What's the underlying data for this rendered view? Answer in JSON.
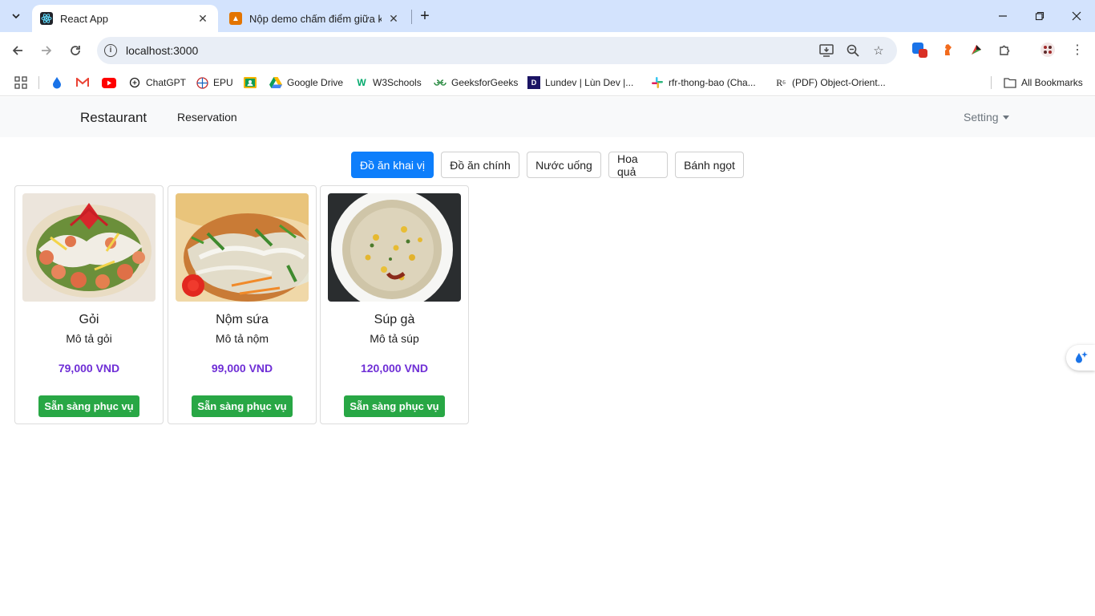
{
  "browser": {
    "tabs": [
      {
        "title": "React App",
        "active": true
      },
      {
        "title": "Nộp demo chấm điểm giữa kỳ",
        "active": false
      }
    ],
    "url": "localhost:3000",
    "bookmarks": [
      {
        "label": "ChatGPT"
      },
      {
        "label": "EPU"
      },
      {
        "label": "Google Drive"
      },
      {
        "label": "W3Schools"
      },
      {
        "label": "GeeksforGeeks"
      },
      {
        "label": "Lundev | Lùn Dev |..."
      },
      {
        "label": "rfr-thong-bao (Cha..."
      },
      {
        "label": "(PDF) Object-Orient..."
      }
    ],
    "all_bookmarks": "All Bookmarks",
    "extension_badge": "1"
  },
  "app": {
    "brand": "Restaurant",
    "nav_link": "Reservation",
    "setting": "Setting",
    "categories": [
      {
        "label": "Đồ ăn khai vị",
        "active": true
      },
      {
        "label": "Đồ ăn chính",
        "active": false
      },
      {
        "label": "Nước uống",
        "active": false
      },
      {
        "label": "Hoa quả",
        "active": false
      },
      {
        "label": "Bánh ngọt",
        "active": false
      }
    ],
    "items": [
      {
        "name": "Gỏi",
        "description": "Mô tả gỏi",
        "price": "79,000 VND",
        "status": "Sẵn sàng phục vụ"
      },
      {
        "name": "Nộm sứa",
        "description": "Mô tả nộm",
        "price": "99,000 VND",
        "status": "Sẵn sàng phục vụ"
      },
      {
        "name": "Súp gà",
        "description": "Mô tả súp",
        "price": "120,000 VND",
        "status": "Sẵn sàng phục vụ"
      }
    ]
  },
  "colors": {
    "active_button": "#0d7efb",
    "price": "#6f2fd6",
    "serve_button": "#28a745",
    "navbar_bg": "#f8f9fa",
    "tabstrip_bg": "#d3e3fd"
  }
}
